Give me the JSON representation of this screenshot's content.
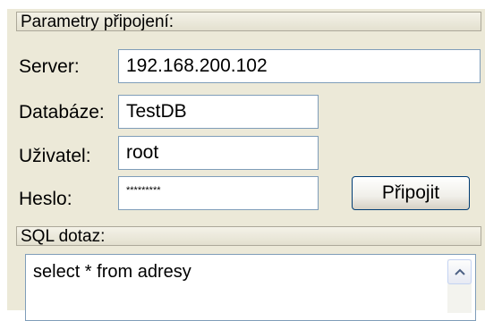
{
  "connection": {
    "header": "Parametry připojení:",
    "server_label": "Server:",
    "server_value": "192.168.200.102",
    "database_label": "Databáze:",
    "database_value": "TestDB",
    "user_label": "Uživatel:",
    "user_value": "root",
    "password_label": "Heslo:",
    "password_value": "*********",
    "connect_button": "Připojit"
  },
  "query": {
    "header": "SQL dotaz:",
    "text": "select * from adresy"
  },
  "icons": {
    "scroll_up": "chevron-up-icon"
  }
}
